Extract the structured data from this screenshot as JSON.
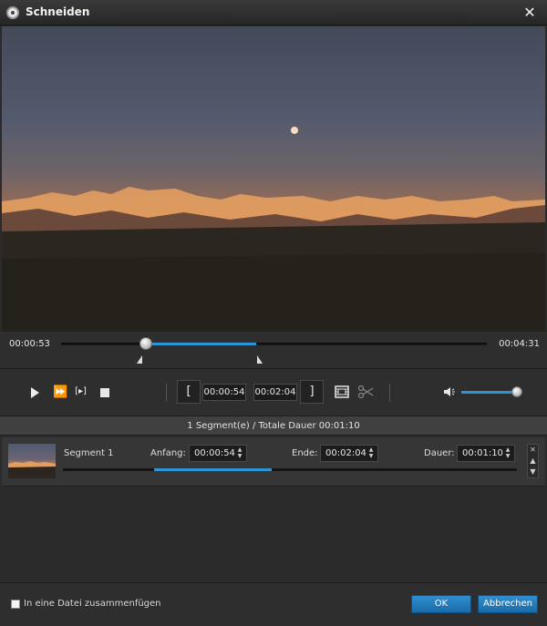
{
  "window": {
    "title": "Schneiden",
    "icon": "app-logo-icon",
    "close_icon": "close-icon"
  },
  "video": {
    "icons": [
      "video-preview"
    ]
  },
  "timeline": {
    "current_time": "00:00:53",
    "total_time": "00:04:31",
    "progress_fraction": 0.2,
    "selection_start_fraction": 0.2,
    "selection_end_fraction": 0.46
  },
  "toolbar": {
    "play_icon": "play-icon",
    "fast_forward_icon": "fast-forward-icon",
    "frame_icon": "frame-step-icon",
    "stop_icon": "stop-icon",
    "start_bracket": "[",
    "start_time": "00:00:54",
    "end_time": "00:02:04",
    "end_bracket": "]",
    "segment_icon": "film-segment-icon",
    "cut_icon": "scissors-icon",
    "volume_icon": "speaker-icon",
    "volume_fraction": 1.0
  },
  "summary": {
    "text": "1 Segment(e) / Totale Dauer 00:01:10"
  },
  "segments": [
    {
      "name": "Segment 1",
      "start_label": "Anfang:",
      "start_value": "00:00:54",
      "end_label": "Ende:",
      "end_value": "00:02:04",
      "duration_label": "Dauer:",
      "duration_value": "00:01:10"
    }
  ],
  "segment_side_controls": [
    "✕",
    "▲",
    "▼"
  ],
  "footer": {
    "merge_label": "In eine Datei zusammenfügen",
    "merge_checked": false,
    "ok_label": "OK",
    "cancel_label": "Abbrechen"
  },
  "colors": {
    "accent": "#2b95d8",
    "background": "#2b2b2b",
    "button": "#1f7dc0"
  }
}
